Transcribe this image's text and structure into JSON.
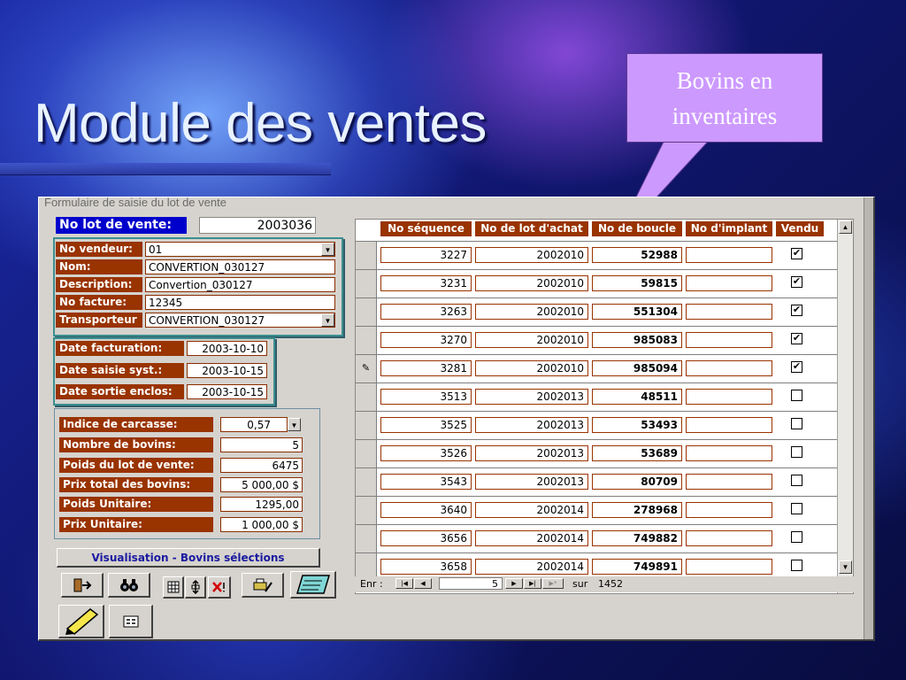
{
  "slide": {
    "title": "Module des ventes",
    "callout": "Bovins en inventaires"
  },
  "form": {
    "caption": "Formulaire de saisie du lot de vente",
    "lot": {
      "label": "No lot de vente:",
      "value": "2003036"
    },
    "vendor": [
      {
        "label": "No vendeur:",
        "value": "01"
      },
      {
        "label": "Nom:",
        "value": "CONVERTION_030127"
      },
      {
        "label": "Description:",
        "value": "Convertion_030127"
      },
      {
        "label": "No facture:",
        "value": "12345"
      },
      {
        "label": "Transporteur",
        "value": "CONVERTION_030127"
      }
    ],
    "dates": [
      {
        "label": "Date facturation:",
        "value": "2003-10-10"
      },
      {
        "label": "Date saisie syst.:",
        "value": "2003-10-15"
      },
      {
        "label": "Date sortie enclos:",
        "value": "2003-10-15"
      }
    ],
    "summary": [
      {
        "label": "Indice de carcasse:",
        "value": "0,57"
      },
      {
        "label": "Nombre de bovins:",
        "value": "5"
      },
      {
        "label": "Poids du lot de  vente:",
        "value": "6475"
      },
      {
        "label": "Prix total des bovins:",
        "value": "5 000,00 $"
      },
      {
        "label": "Poids Unitaire:",
        "value": "1295,00"
      },
      {
        "label": "Prix Unitaire:",
        "value": "1 000,00 $"
      }
    ],
    "visu_button": "Visualisation - Bovins sélections"
  },
  "grid": {
    "headers": [
      "No séquence",
      "No de lot d'achat",
      "No de boucle",
      "No d'implant",
      "Vendu"
    ],
    "rows": [
      {
        "seq": "3227",
        "lot": "2002010",
        "boucle": "52988",
        "implant": "",
        "vendu": true
      },
      {
        "seq": "3231",
        "lot": "2002010",
        "boucle": "59815",
        "implant": "",
        "vendu": true
      },
      {
        "seq": "3263",
        "lot": "2002010",
        "boucle": "551304",
        "implant": "",
        "vendu": true
      },
      {
        "seq": "3270",
        "lot": "2002010",
        "boucle": "985083",
        "implant": "",
        "vendu": true
      },
      {
        "seq": "3281",
        "lot": "2002010",
        "boucle": "985094",
        "implant": "",
        "vendu": true
      },
      {
        "seq": "3513",
        "lot": "2002013",
        "boucle": "48511",
        "implant": "",
        "vendu": false
      },
      {
        "seq": "3525",
        "lot": "2002013",
        "boucle": "53493",
        "implant": "",
        "vendu": false
      },
      {
        "seq": "3526",
        "lot": "2002013",
        "boucle": "53689",
        "implant": "",
        "vendu": false
      },
      {
        "seq": "3543",
        "lot": "2002013",
        "boucle": "80709",
        "implant": "",
        "vendu": false
      },
      {
        "seq": "3640",
        "lot": "2002014",
        "boucle": "278968",
        "implant": "",
        "vendu": false
      },
      {
        "seq": "3656",
        "lot": "2002014",
        "boucle": "749882",
        "implant": "",
        "vendu": false
      },
      {
        "seq": "3658",
        "lot": "2002014",
        "boucle": "749891",
        "implant": "",
        "vendu": false
      }
    ],
    "edit_marker": "✎"
  },
  "nav": {
    "label": "Enr :",
    "current": "5",
    "of_label": "sur",
    "total": "1452"
  }
}
